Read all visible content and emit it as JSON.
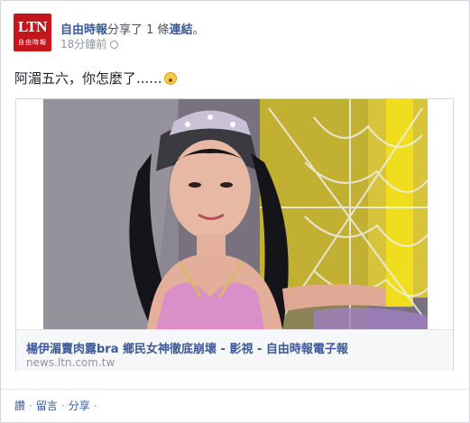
{
  "post": {
    "avatar_text": "LTN",
    "avatar_subtext": "自由時報",
    "page_name": "自由時報",
    "shared_text": "分享了 1 條",
    "link_word": "連結",
    "period": "。",
    "timestamp": "18分鐘前",
    "status": "阿湄五六，你怎麼了......"
  },
  "link": {
    "title": "楊伊湄賣肉露bra 鄉民女神徹底崩壞 - 影視 - 自由時報電子報",
    "domain": "news.ltn.com.tw"
  },
  "actions": {
    "like": "讚",
    "comment": "留言",
    "share": "分享",
    "separator": "·"
  },
  "colors": {
    "brand_red": "#c4161c",
    "link_blue": "#3b5998"
  }
}
